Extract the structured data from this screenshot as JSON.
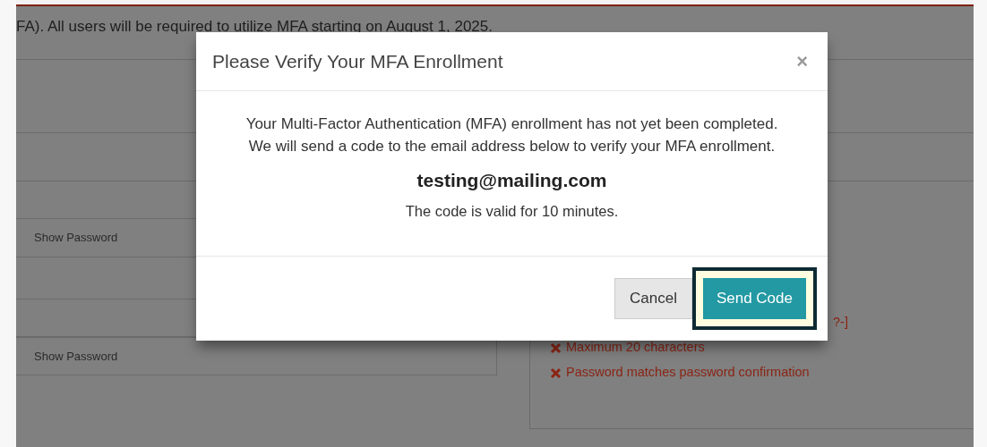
{
  "notice": "FA). All users will be required to utilize MFA starting on August 1, 2025.",
  "password_fields": [
    {
      "toggle": "Show Password"
    },
    {
      "toggle": "Show Password"
    }
  ],
  "password_rules": [
    {
      "kind": "fragment",
      "text": "?-]",
      "met": false
    },
    {
      "kind": "rule",
      "text": "Maximum 20 characters",
      "met": false
    },
    {
      "kind": "rule",
      "text": "Password matches password confirmation",
      "met": false
    }
  ],
  "modal": {
    "title": "Please Verify Your MFA Enrollment",
    "close": "×",
    "message": [
      "Your Multi-Factor Authentication (MFA) enrollment has not yet been completed.",
      "We will send a code to the email address below to verify your MFA enrollment."
    ],
    "email": "testing@mailing.com",
    "validity": "The code is valid for 10 minutes.",
    "buttons": [
      {
        "kind": "secondary",
        "label": "Cancel",
        "focused": false
      },
      {
        "kind": "primary",
        "label": "Send Code",
        "focused": true
      }
    ]
  }
}
